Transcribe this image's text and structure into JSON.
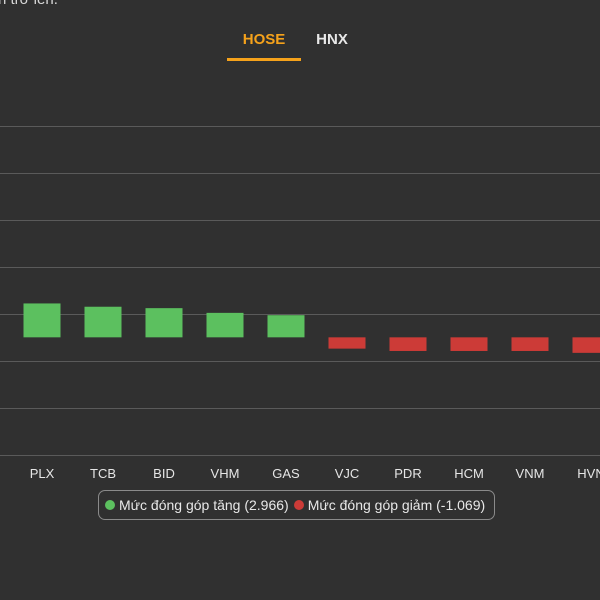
{
  "header": {
    "note": "n trở lên."
  },
  "tabs": [
    {
      "label": "HOSE",
      "active": true
    },
    {
      "label": "HNX",
      "active": false
    }
  ],
  "colors": {
    "accent": "#f5a21b",
    "positive": "#5cc05f",
    "negative": "#cc3b37",
    "grid": "#5a5a5a",
    "background": "#303030"
  },
  "legend": {
    "positive_label": "Mức đóng góp tăng (2.966)",
    "negative_label": "Mức đóng góp giảm (-1.069)"
  },
  "chart_data": {
    "type": "bar",
    "title": "",
    "xlabel": "",
    "ylabel": "",
    "grid": true,
    "legend_position": "bottom",
    "categories": [
      "PLX",
      "TCB",
      "BID",
      "VHM",
      "GAS",
      "VJC",
      "PDR",
      "HCM",
      "VNM",
      "HVN"
    ],
    "values": [
      0.72,
      0.65,
      0.62,
      0.52,
      0.47,
      -0.24,
      -0.29,
      -0.29,
      -0.29,
      -0.33
    ],
    "ylim": [
      -2.5,
      5.0
    ],
    "series": [
      {
        "name": "Mức đóng góp tăng (2.966)",
        "color": "#5cc05f"
      },
      {
        "name": "Mức đóng góp giảm (-1.069)",
        "color": "#cc3b37"
      }
    ]
  }
}
